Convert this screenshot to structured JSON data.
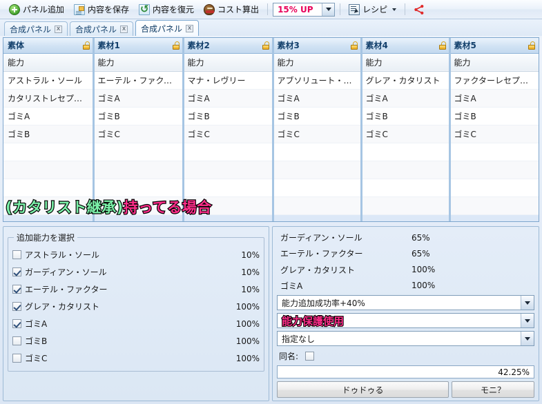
{
  "toolbar": {
    "buttons": [
      {
        "label": "パネル追加",
        "icon": "add-circle-icon"
      },
      {
        "label": "内容を保存",
        "icon": "save-icon"
      },
      {
        "label": "内容を復元",
        "icon": "restore-icon"
      },
      {
        "label": "コスト算出",
        "icon": "cost-icon"
      }
    ],
    "cost_combo": {
      "value": "15% UP"
    },
    "recipe": {
      "label": "レシピ",
      "icon": "recipe-icon"
    },
    "share": {
      "icon": "share-icon",
      "color": "#e02b2b"
    }
  },
  "tabs": [
    {
      "label": "合成パネル",
      "close": "x",
      "active": false
    },
    {
      "label": "合成パネル",
      "close": "x",
      "active": false
    },
    {
      "label": "合成パネル",
      "close": "x",
      "active": true
    }
  ],
  "grid": {
    "columns": [
      {
        "title": "素体",
        "lock": "lock-icon"
      },
      {
        "title": "素材1",
        "lock": "lock-icon"
      },
      {
        "title": "素材2",
        "lock": "lock-icon"
      },
      {
        "title": "素材3",
        "lock": "lock-icon"
      },
      {
        "title": "素材4",
        "lock": "lock-icon"
      },
      {
        "title": "素材5",
        "lock": "lock-icon"
      }
    ],
    "subheader": [
      "能力",
      "能力",
      "能力",
      "能力",
      "能力",
      "能力"
    ],
    "rows": [
      [
        "アストラル・ソール",
        "エーテル・ファクター",
        "マナ・レヴリー",
        "アブソリュート・グ...",
        "グレア・カタリスト",
        "ファクターレセプター"
      ],
      [
        "カタリストレセプター",
        "ゴミA",
        "ゴミA",
        "ゴミA",
        "ゴミA",
        "ゴミA"
      ],
      [
        "ゴミA",
        "ゴミB",
        "ゴミB",
        "ゴミB",
        "ゴミB",
        "ゴミB"
      ],
      [
        "ゴミB",
        "ゴミC",
        "ゴミC",
        "ゴミC",
        "ゴミC",
        "ゴミC"
      ],
      [
        "",
        "",
        "",
        "",
        "",
        ""
      ],
      [
        "",
        "",
        "",
        "",
        "",
        ""
      ],
      [
        "",
        "",
        "",
        "",
        "",
        ""
      ],
      [
        "",
        "",
        "",
        "",
        "",
        ""
      ],
      [
        "",
        "",
        "",
        "",
        "",
        ""
      ]
    ]
  },
  "annotation": {
    "part1": "(カタリスト継承)",
    "part2": "持ってる場合",
    "color1": "#7bf0a8",
    "color2": "#ff2e8a"
  },
  "left_panel": {
    "group_title": "追加能力を選択",
    "abilities": [
      {
        "name": "アストラル・ソール",
        "percent": "10%",
        "checked": false
      },
      {
        "name": "ガーディアン・ソール",
        "percent": "10%",
        "checked": true
      },
      {
        "name": "エーテル・ファクター",
        "percent": "10%",
        "checked": true
      },
      {
        "name": "グレア・カタリスト",
        "percent": "100%",
        "checked": true
      },
      {
        "name": "ゴミA",
        "percent": "100%",
        "checked": true
      },
      {
        "name": "ゴミB",
        "percent": "100%",
        "checked": false
      },
      {
        "name": "ゴミC",
        "percent": "100%",
        "checked": false
      }
    ]
  },
  "right_panel": {
    "results": [
      {
        "name": "ガーディアン・ソール",
        "percent": "65%"
      },
      {
        "name": "エーテル・ファクター",
        "percent": "65%"
      },
      {
        "name": "グレア・カタリスト",
        "percent": "100%"
      },
      {
        "name": "ゴミA",
        "percent": "100%"
      }
    ],
    "combos": [
      {
        "value": "能力追加成功率+40%",
        "highlight": false
      },
      {
        "value": "能力保護使用",
        "highlight": true
      },
      {
        "value": "指定なし",
        "highlight": false
      }
    ],
    "same_name": {
      "label": "同名:",
      "checked": false
    },
    "total_percent": "42.25%",
    "buttons": {
      "primary": "ドゥドゥる",
      "secondary": "モニ？"
    }
  }
}
